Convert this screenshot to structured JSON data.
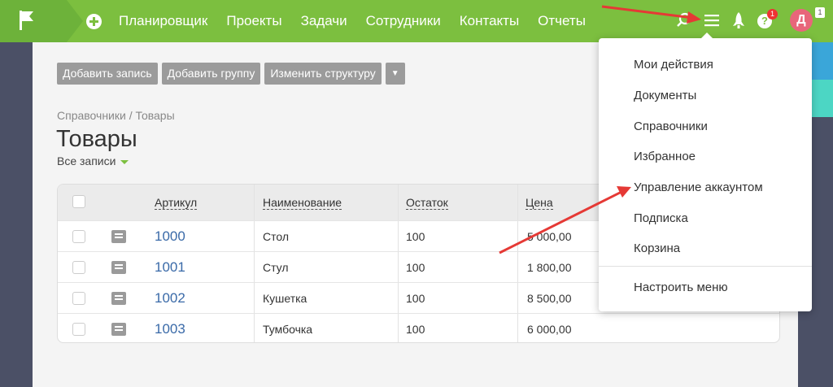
{
  "topbar": {
    "nav": [
      "Планировщик",
      "Проекты",
      "Задачи",
      "Сотрудники",
      "Контакты",
      "Отчеты"
    ],
    "help_badge": "1",
    "avatar_letter": "Д",
    "avatar_badge": "1",
    "help_glyph": "?",
    "accent": "#7cbf3f"
  },
  "toolbar": {
    "add_record": "Добавить запись",
    "add_group": "Добавить группу",
    "change_structure": "Изменить структуру",
    "more": "▼"
  },
  "breadcrumb": "Справочники / Товары",
  "page_title": "Товары",
  "filter": "Все записи",
  "table": {
    "headers": {
      "sku": "Артикул",
      "name": "Наименование",
      "stock": "Остаток",
      "price": "Цена"
    },
    "rows": [
      {
        "sku": "1000",
        "name": "Стол",
        "stock": "100",
        "price": "5 000,00"
      },
      {
        "sku": "1001",
        "name": "Стул",
        "stock": "100",
        "price": "1 800,00"
      },
      {
        "sku": "1002",
        "name": "Кушетка",
        "stock": "100",
        "price": "8 500,00"
      },
      {
        "sku": "1003",
        "name": "Тумбочка",
        "stock": "100",
        "price": "6 000,00"
      }
    ]
  },
  "menu": {
    "items": [
      "Мои действия",
      "Документы",
      "Справочники",
      "Избранное",
      "Управление аккаунтом",
      "Подписка",
      "Корзина"
    ],
    "configure": "Настроить меню"
  },
  "icons": [
    "flag-icon",
    "plus-icon",
    "search-icon",
    "hamburger-menu-icon",
    "rocket-icon",
    "help-icon",
    "doc-icon",
    "checkbox-icon"
  ]
}
